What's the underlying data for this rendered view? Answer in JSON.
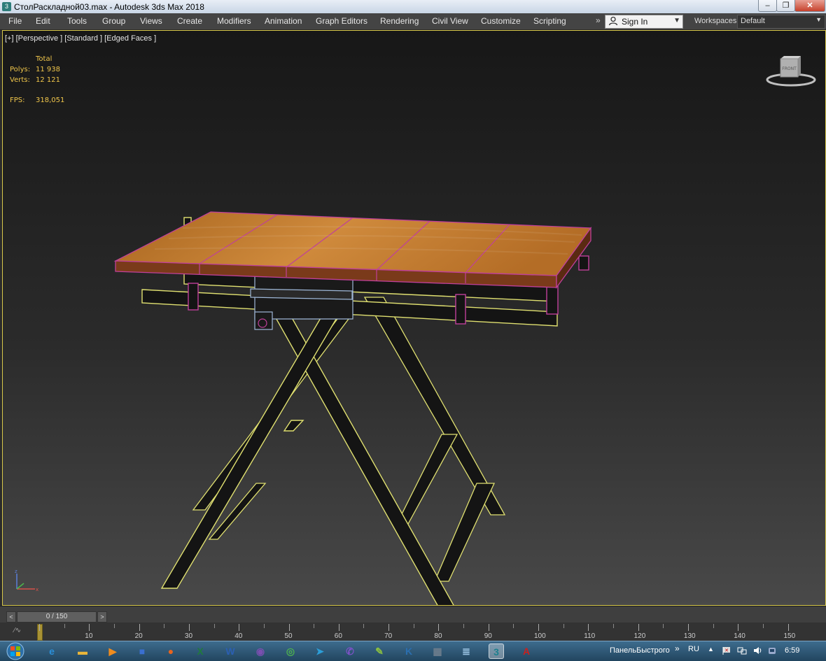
{
  "window": {
    "title": "СтолРаскладной03.max - Autodesk 3ds Max 2018",
    "app_icon_letter": "3",
    "controls": [
      "minimize",
      "maximize",
      "close"
    ]
  },
  "menu": {
    "items": [
      "File",
      "Edit",
      "Tools",
      "Group",
      "Views",
      "Create",
      "Modifiers",
      "Animation",
      "Graph Editors",
      "Rendering",
      "Civil View",
      "Customize",
      "Scripting"
    ],
    "overflow": "»",
    "sign_in": "Sign In",
    "workspaces_label": "Workspaces:",
    "workspace_value": "Default"
  },
  "viewport": {
    "label": "[+] [Perspective ] [Standard ] [Edged Faces ]",
    "stats": {
      "total_label": "Total",
      "polys_label": "Polys:",
      "polys_value": "11 938",
      "verts_label": "Verts:",
      "verts_value": "12 121",
      "fps_label": "FPS:",
      "fps_value": "318,051"
    },
    "viewcube_face": "FRONT",
    "colors": {
      "wireframe": "#e0e070",
      "selection": "#c0409a",
      "wood": "#c07a30",
      "metal": "#1a1a1a",
      "hardware": "#9fb8d8"
    }
  },
  "timeline": {
    "frame_display": "0 / 150",
    "ticks": [
      "0",
      "10",
      "20",
      "30",
      "40",
      "50",
      "60",
      "70",
      "80",
      "90",
      "100",
      "110",
      "120",
      "130",
      "140",
      "150"
    ]
  },
  "taskbar": {
    "apps": [
      {
        "name": "ie",
        "glyph": "e",
        "color": "#2a8fd9"
      },
      {
        "name": "explorer",
        "glyph": "▬",
        "color": "#e8b53a"
      },
      {
        "name": "media-player",
        "glyph": "▶",
        "color": "#f08c1e"
      },
      {
        "name": "app-drive",
        "glyph": "■",
        "color": "#3a6fd0"
      },
      {
        "name": "firefox",
        "glyph": "●",
        "color": "#e8641e"
      },
      {
        "name": "excel",
        "glyph": "X",
        "color": "#1f7a3d"
      },
      {
        "name": "word",
        "glyph": "W",
        "color": "#2b5fb3"
      },
      {
        "name": "tor",
        "glyph": "◉",
        "color": "#7a4fb0"
      },
      {
        "name": "chrome",
        "glyph": "◎",
        "color": "#4caf50"
      },
      {
        "name": "telegram",
        "glyph": "➤",
        "color": "#2c9ed8"
      },
      {
        "name": "viber",
        "glyph": "✆",
        "color": "#7d52c7"
      },
      {
        "name": "notes",
        "glyph": "✎",
        "color": "#8bbf40"
      },
      {
        "name": "kompas",
        "glyph": "K",
        "color": "#2b6fb0"
      },
      {
        "name": "calculator",
        "glyph": "▦",
        "color": "#6d7d8c"
      },
      {
        "name": "notepad",
        "glyph": "≣",
        "color": "#9fc8e8"
      },
      {
        "name": "3dsmax",
        "glyph": "3",
        "color": "#1c7f8e"
      },
      {
        "name": "autocad",
        "glyph": "A",
        "color": "#c8201e"
      }
    ],
    "toolbar_label": "ПанельБыстрого",
    "chevron": "»",
    "language": "RU",
    "time": "6:59"
  }
}
